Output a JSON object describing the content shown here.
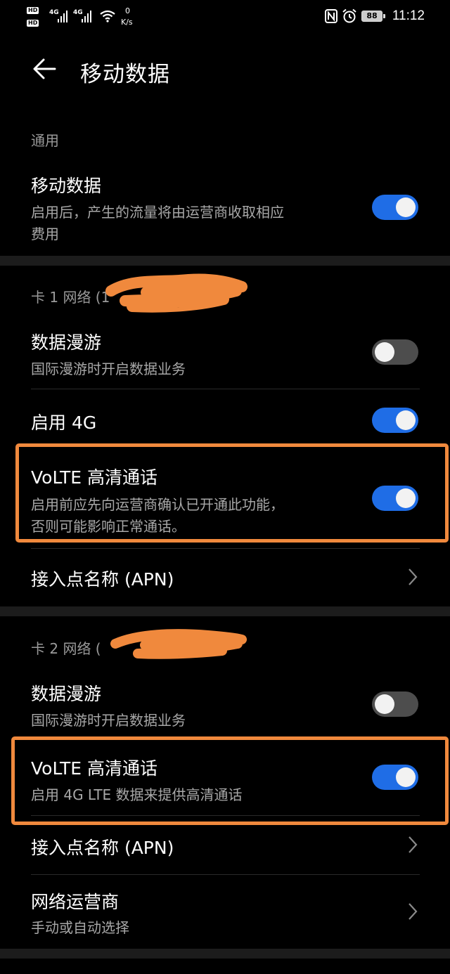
{
  "status_bar": {
    "hd1": "HD",
    "hd2": "HD",
    "net1": "4G",
    "net2": "4G",
    "speed_value": "0",
    "speed_unit": "K/s",
    "battery": "88",
    "time": "11:12",
    "icons": [
      "nfc-icon",
      "alarm-icon",
      "battery-icon",
      "wifi-icon",
      "signal-icon"
    ]
  },
  "header": {
    "title": "移动数据",
    "back_icon": "arrow-left-icon"
  },
  "general": {
    "section_label": "通用",
    "mobile_data": {
      "title": "移动数据",
      "subtitle_line1": "启用后，产生的流量将由运营商收取相应",
      "subtitle_line2": "费用",
      "enabled": true
    }
  },
  "sim1": {
    "section_label": "卡 1 网络 (1",
    "section_label_tail": "",
    "roaming": {
      "title": "数据漫游",
      "subtitle": "国际漫游时开启数据业务",
      "enabled": false
    },
    "enable_4g": {
      "title": "启用 4G",
      "enabled": true
    },
    "volte": {
      "title": "VoLTE 高清通话",
      "subtitle_line1": "启用前应先向运营商确认已开通此功能，",
      "subtitle_line2": "否则可能影响正常通话。",
      "enabled": true
    },
    "apn": {
      "title": "接入点名称 (APN)"
    }
  },
  "sim2": {
    "section_label": "卡 2 网络 (",
    "roaming": {
      "title": "数据漫游",
      "subtitle": "国际漫游时开启数据业务",
      "enabled": false
    },
    "volte": {
      "title": "VoLTE 高清通话",
      "subtitle": "启用 4G LTE 数据来提供高清通话",
      "enabled": true
    },
    "apn": {
      "title": "接入点名称 (APN)"
    },
    "operator": {
      "title": "网络运营商",
      "subtitle": "手动或自动选择"
    }
  },
  "colors": {
    "toggle_on": "#1f6de6",
    "toggle_off": "#4d4d4d",
    "highlight": "#f0893d",
    "redaction": "#f0893d"
  }
}
